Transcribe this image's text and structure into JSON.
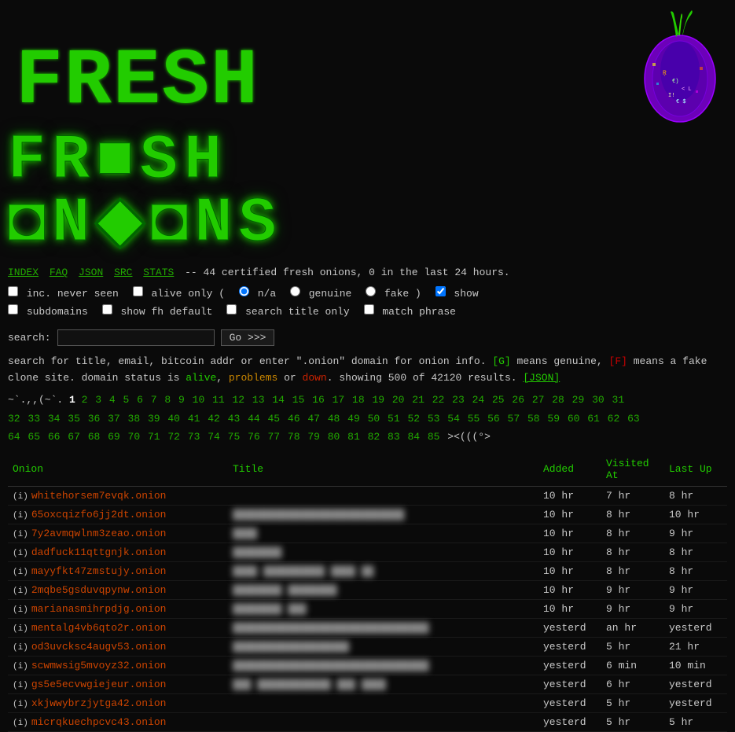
{
  "header": {
    "title": "FRESH ONIONS",
    "logo_alt": "Fresh Onions Logo"
  },
  "nav": {
    "items": [
      {
        "label": "INDEX",
        "href": "#"
      },
      {
        "label": "FAQ",
        "href": "#"
      },
      {
        "label": "JSON",
        "href": "#"
      },
      {
        "label": "SRC",
        "href": "#"
      },
      {
        "label": "STATS",
        "href": "#"
      }
    ],
    "stats_text": "-- 44 certified fresh onions, 0 in the last 24 hours."
  },
  "controls": {
    "inc_never_seen_label": "inc. never seen",
    "alive_only_label": "alive only (",
    "na_label": "n/a",
    "genuine_label": "genuine",
    "fake_label": "fake )",
    "show_label": "show",
    "subdomains_label": "subdomains",
    "show_fh_label": "show fh default",
    "search_title_label": "search title only",
    "match_phrase_label": "match phrase"
  },
  "search": {
    "label": "search:",
    "placeholder": "",
    "button_label": "Go >>>"
  },
  "info": {
    "text1": "search for title, email, bitcoin addr or enter \".onion\" domain for onion info.",
    "genuine_badge": "[G]",
    "genuine_note": "means genuine,",
    "fake_badge": "[F]",
    "fake_note": "means a fake clone site. domain status is",
    "alive_word": "alive",
    "comma1": ",",
    "problems_word": "problems",
    "or_word": "or",
    "down_word": "down",
    "period": ".",
    "showing_text": "showing 500 of 42120 results.",
    "json_link": "[JSON]"
  },
  "pagination": {
    "prev_arrow": "~`.,,(~`.",
    "pages": [
      "1",
      "2",
      "3",
      "4",
      "5",
      "6",
      "7",
      "8",
      "9",
      "10",
      "11",
      "12",
      "13",
      "14",
      "15",
      "16",
      "17",
      "18",
      "19",
      "20",
      "21",
      "22",
      "23",
      "24",
      "25",
      "26",
      "27",
      "28",
      "29",
      "30",
      "31",
      "32",
      "33",
      "34",
      "35",
      "36",
      "37",
      "38",
      "39",
      "40",
      "41",
      "42",
      "43",
      "44",
      "45",
      "46",
      "47",
      "48",
      "49",
      "50",
      "51",
      "52",
      "53",
      "54",
      "55",
      "56",
      "57",
      "58",
      "59",
      "60",
      "61",
      "62",
      "63",
      "64",
      "65",
      "66",
      "67",
      "68",
      "69",
      "70",
      "71",
      "72",
      "73",
      "74",
      "75",
      "76",
      "77",
      "78",
      "79",
      "80",
      "81",
      "82",
      "83",
      "84",
      "85"
    ],
    "special": "><(((°>"
  },
  "table": {
    "headers": [
      "Onion",
      "Title",
      "Added",
      "Visited At",
      "Last Up"
    ],
    "rows": [
      {
        "onion": "whitehorsem7evqk.onion",
        "title": "",
        "added": "10 hr",
        "visited": "7 hr",
        "lastup": "8 hr",
        "blurred": false
      },
      {
        "onion": "65oxcqizfo6jj2dt.onion",
        "title": "████████████████████████████",
        "added": "10 hr",
        "visited": "8 hr",
        "lastup": "10 hr",
        "blurred": true
      },
      {
        "onion": "7y2avmqwlnm3zeao.onion",
        "title": "████",
        "added": "10 hr",
        "visited": "8 hr",
        "lastup": "9 hr",
        "blurred": true
      },
      {
        "onion": "dadfuck11qttgnjk.onion",
        "title": "████████",
        "added": "10 hr",
        "visited": "8 hr",
        "lastup": "8 hr",
        "blurred": true
      },
      {
        "onion": "mayyfkt47zmstujy.onion",
        "title": "████ ██████████ ████ ██",
        "added": "10 hr",
        "visited": "8 hr",
        "lastup": "8 hr",
        "blurred": true
      },
      {
        "onion": "2mqbe5gsduvqpynw.onion",
        "title": "████████ ████████",
        "added": "10 hr",
        "visited": "9 hr",
        "lastup": "9 hr",
        "blurred": true
      },
      {
        "onion": "marianasmihrpdjg.onion",
        "title": "████████ ███",
        "added": "10 hr",
        "visited": "9 hr",
        "lastup": "9 hr",
        "blurred": true
      },
      {
        "onion": "mentalg4vb6qto2r.onion",
        "title": "████████████████████████████████",
        "added": "yesterd",
        "visited": "an hr",
        "lastup": "yesterd",
        "blurred": true
      },
      {
        "onion": "od3uvcksc4augv53.onion",
        "title": "███████████████████",
        "added": "yesterd",
        "visited": "5 hr",
        "lastup": "21 hr",
        "blurred": true
      },
      {
        "onion": "scwmwsig5mvoyz32.onion",
        "title": "████████████████████████████████",
        "added": "yesterd",
        "visited": "6 min",
        "lastup": "10 min",
        "blurred": true
      },
      {
        "onion": "gs5e5ecvwgiejeur.onion",
        "title": "███ ████████████ ███ ████",
        "added": "yesterd",
        "visited": "6 hr",
        "lastup": "yesterd",
        "blurred": true
      },
      {
        "onion": "xkjwwybrzjytga42.onion",
        "title": "",
        "added": "yesterd",
        "visited": "5 hr",
        "lastup": "yesterd",
        "blurred": false
      },
      {
        "onion": "micrqkuechpcvc43.onion",
        "title": "",
        "added": "yesterd",
        "visited": "5 hr",
        "lastup": "5 hr",
        "blurred": false
      }
    ]
  }
}
